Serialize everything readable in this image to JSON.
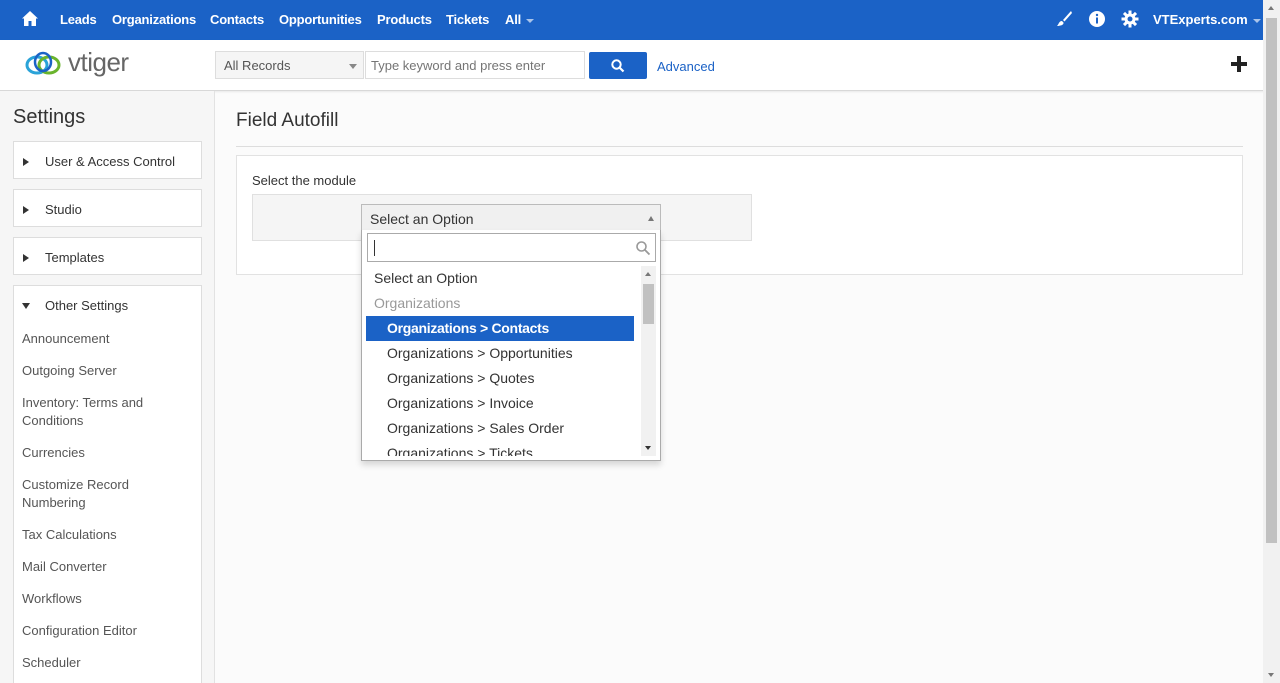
{
  "topnav": {
    "items": [
      "Leads",
      "Organizations",
      "Contacts",
      "Opportunities",
      "Products",
      "Tickets",
      "All"
    ],
    "user": "VTExperts.com",
    "bg_color": "#1b62c6"
  },
  "searchbar": {
    "logo_text": "vtiger",
    "scope": "All Records",
    "search_placeholder": "Type keyword and press enter",
    "advanced": "Advanced"
  },
  "sidebar": {
    "title": "Settings",
    "sections": [
      "User & Access Control",
      "Studio",
      "Templates",
      "Other Settings"
    ],
    "items": [
      "Announcement",
      "Outgoing Server",
      "Inventory: Terms and Conditions",
      "Currencies",
      "Customize Record Numbering",
      "Tax Calculations",
      "Mail Converter",
      "Workflows",
      "Configuration Editor",
      "Scheduler"
    ]
  },
  "main": {
    "title": "Field Autofill",
    "module_label": "Select the module",
    "select_value": "Select an Option"
  },
  "dropdown": {
    "options": [
      {
        "label": "Select an Option",
        "kind": "option"
      },
      {
        "label": "Organizations",
        "kind": "group"
      },
      {
        "label": "Organizations > Contacts",
        "kind": "child",
        "highlighted": true
      },
      {
        "label": "Organizations > Opportunities",
        "kind": "child"
      },
      {
        "label": "Organizations > Quotes",
        "kind": "child"
      },
      {
        "label": "Organizations > Invoice",
        "kind": "child"
      },
      {
        "label": "Organizations > Sales Order",
        "kind": "child"
      },
      {
        "label": "Organizations > Tickets",
        "kind": "child"
      }
    ]
  }
}
